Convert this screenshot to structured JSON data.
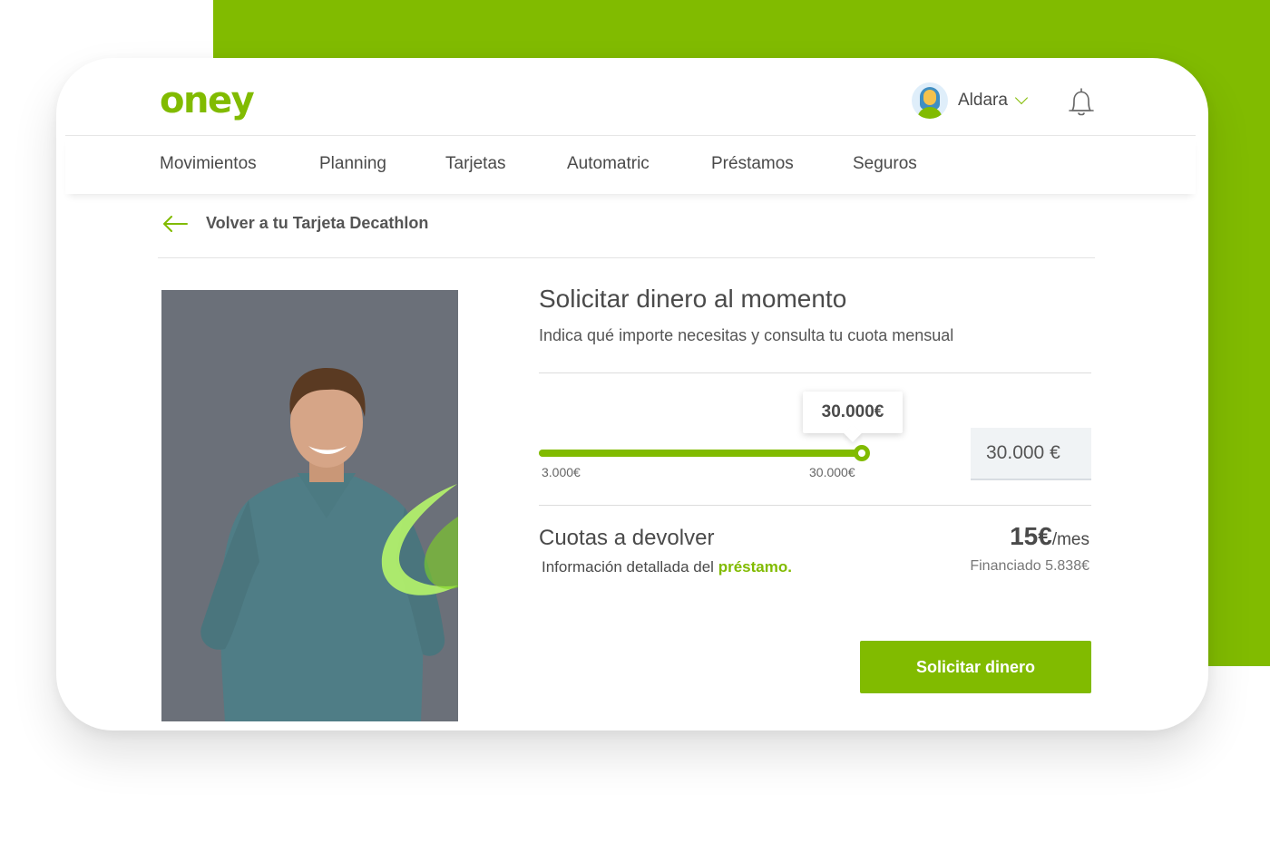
{
  "brand": {
    "logo_text": "oney",
    "accent_color": "#81bb00"
  },
  "user": {
    "name": "Aldara",
    "avatar_icon": "user-avatar-icon",
    "menu_icon": "chevron-down-icon"
  },
  "notifications": {
    "icon": "bell-icon"
  },
  "nav": {
    "items": [
      {
        "label": "Movimientos"
      },
      {
        "label": "Planning"
      },
      {
        "label": "Tarjetas"
      },
      {
        "label": "Automatric"
      },
      {
        "label": "Préstamos"
      },
      {
        "label": "Seguros"
      }
    ]
  },
  "back_link": {
    "label": "Volver a tu Tarjeta Decathlon",
    "icon": "arrow-left-icon"
  },
  "panel": {
    "title": "Solicitar dinero al momento",
    "subtitle": "Indica qué importe necesitas y consulta tu cuota mensual",
    "slider": {
      "min_label": "3.000€",
      "max_label": "30.000€",
      "tooltip": "30.000€",
      "value_fraction": 1.0
    },
    "amount_input_value": "30.000 €",
    "cuotas": {
      "title": "Cuotas a devolver",
      "info_prefix": "Información detallada del ",
      "info_link": "préstamo.",
      "fee_amount": "15€",
      "fee_unit": "/mes",
      "financed": "Financiado 5.838€"
    },
    "cta_label": "Solicitar dinero"
  }
}
